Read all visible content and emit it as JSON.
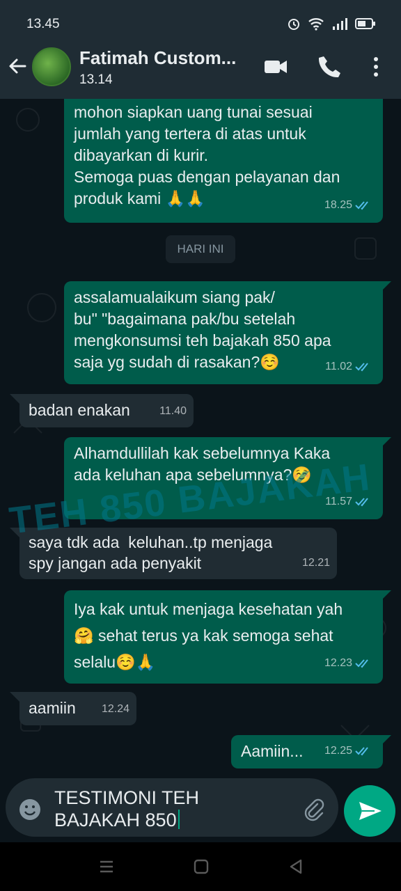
{
  "status_bar": {
    "time": "13.45"
  },
  "header": {
    "contact_name": "Fatimah Custom...",
    "contact_status": "13.14"
  },
  "messages": [
    {
      "direction": "out",
      "text": "mohon siapkan uang tunai sesuai\njumlah yang tertera di atas untuk\ndibayarkan di kurir.\nSemoga puas dengan pelayanan dan\nproduk kami 🙏🙏",
      "time": "18.25",
      "read": true
    },
    {
      "type": "date",
      "text": "HARI INI"
    },
    {
      "direction": "out",
      "text": "assalamualaikum siang pak/\nbu\" \"bagaimana pak/bu setelah\nmengkonsumsi teh bajakah 850 apa\nsaja yg sudah di rasakan?☺️",
      "time": "11.02",
      "read": true
    },
    {
      "direction": "in",
      "text": "badan enakan",
      "time": "11.40"
    },
    {
      "direction": "out",
      "text": "Alhamdullilah kak sebelumnya Kaka\nada keluhan apa sebelumnya?☺️",
      "time": "11.57",
      "read": true
    },
    {
      "direction": "in",
      "text": "saya tdk ada  keluhan..tp menjaga\nspy jangan ada penyakit",
      "time": "12.21"
    },
    {
      "direction": "out",
      "text": "Iya kak untuk menjaga kesehatan yah\n🤗 sehat terus ya kak semoga sehat\nselalu☺️🙏",
      "time": "12.23",
      "read": true
    },
    {
      "direction": "in",
      "text": "aamiin",
      "time": "12.24"
    },
    {
      "direction": "out",
      "text": "Aamiin...",
      "time": "12.25",
      "read": true
    }
  ],
  "watermark": "TEH 850 BAJAKAH",
  "composer": {
    "text": "TESTIMONI TEH\nBAJAKAH 850"
  },
  "colors": {
    "header_bg": "#1f2c34",
    "chat_bg": "#0b141a",
    "outgoing_bubble": "#005c4b",
    "incoming_bubble": "#202c33",
    "read_tick": "#53bdeb",
    "accent": "#00a884"
  },
  "icons": {
    "back": "arrow-left-icon",
    "video": "video-camera-icon",
    "call": "phone-icon",
    "menu": "more-vertical-icon",
    "emoji": "emoji-icon",
    "attach": "paperclip-icon",
    "send": "send-icon"
  }
}
